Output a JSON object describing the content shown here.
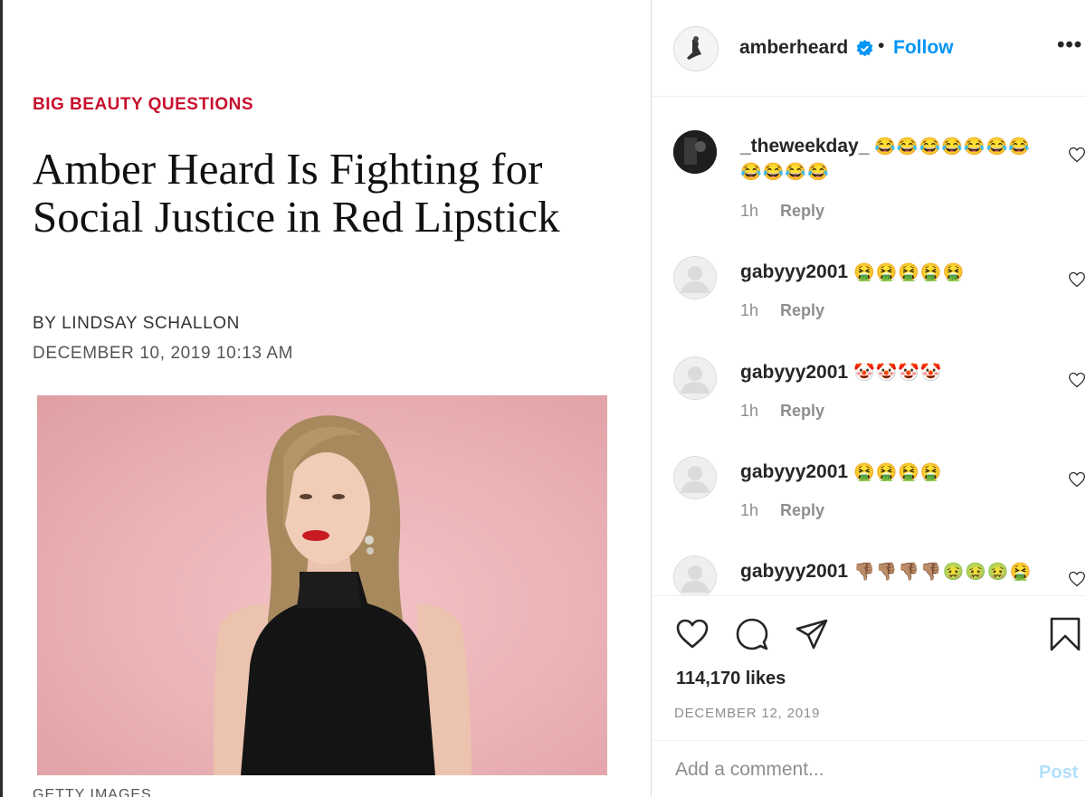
{
  "article": {
    "kicker": "BIG BEAUTY QUESTIONS",
    "headline": "Amber Heard Is Fighting for Social Justice in Red Lipstick",
    "byline": "BY LINDSAY SCHALLON",
    "date": "DECEMBER 10, 2019 10:13 AM",
    "photo_credit": "GETTY IMAGES"
  },
  "post": {
    "username": "amberheard",
    "separator": "•",
    "follow_label": "Follow",
    "more_label": "•••",
    "likes": "114,170 likes",
    "date": "DECEMBER 12, 2019",
    "comment_placeholder": "Add a comment...",
    "post_label": "Post",
    "colors": {
      "link": "#0095f6",
      "verified": "#0095f6",
      "post_disabled": "#b2dffc",
      "kicker": "#c8102e"
    }
  },
  "comments": [
    {
      "user": "_theweekday_",
      "text": "😂😂😂😂😂😂😂😂😂😂😂",
      "time": "1h",
      "reply": "Reply",
      "avatar": "dark"
    },
    {
      "user": "gabyyy2001",
      "text": "🤮🤮🤮🤮🤮",
      "time": "1h",
      "reply": "Reply",
      "avatar": "default"
    },
    {
      "user": "gabyyy2001",
      "text": "🤡🤡🤡🤡",
      "time": "1h",
      "reply": "Reply",
      "avatar": "default"
    },
    {
      "user": "gabyyy2001",
      "text": "🤮🤮🤮🤮",
      "time": "1h",
      "reply": "Reply",
      "avatar": "default"
    },
    {
      "user": "gabyyy2001",
      "text": "👎🏽👎🏽👎🏽👎🏽🤢🤢🤢🤮",
      "time": "",
      "reply": "",
      "avatar": "default"
    }
  ],
  "icons": {
    "verified": "verified-badge-icon",
    "like": "heart-icon",
    "comment": "comment-bubble-icon",
    "share": "paper-plane-icon",
    "save": "bookmark-icon"
  }
}
